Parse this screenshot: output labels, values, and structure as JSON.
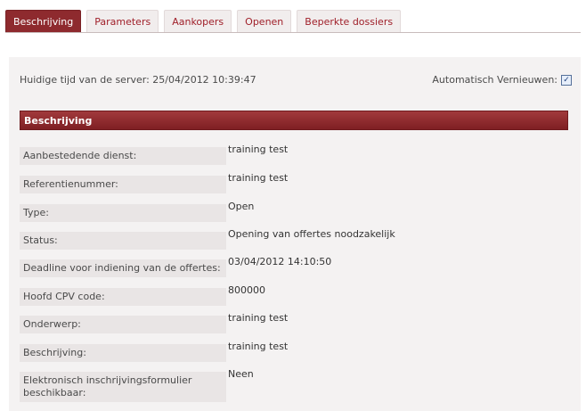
{
  "tabs": [
    {
      "label": "Beschrijving",
      "active": true
    },
    {
      "label": "Parameters",
      "active": false
    },
    {
      "label": "Aankopers",
      "active": false
    },
    {
      "label": "Openen",
      "active": false
    },
    {
      "label": "Beperkte dossiers",
      "active": false
    }
  ],
  "server": {
    "time_text": "Huidige tijd van de server: 25/04/2012 10:39:47",
    "auto_refresh_label": "Automatisch Vernieuwen:",
    "auto_refresh_checked": true
  },
  "section": {
    "title": "Beschrijving"
  },
  "fields": [
    {
      "label": "Aanbestedende dienst:",
      "value": "training test"
    },
    {
      "label": "Referentienummer:",
      "value": "training test"
    },
    {
      "label": "Type:",
      "value": "Open"
    },
    {
      "label": "Status:",
      "value": "Opening van offertes noodzakelijk"
    },
    {
      "label": "Deadline voor indiening van de offertes:",
      "value": "03/04/2012 14:10:50"
    },
    {
      "label": "Hoofd CPV code:",
      "value": "800000"
    },
    {
      "label": "Onderwerp:",
      "value": "training test"
    },
    {
      "label": "Beschrijving:",
      "value": "training test"
    },
    {
      "label": "Elektronisch inschrijvingsformulier beschikbaar:",
      "value": "Neen"
    }
  ],
  "colors": {
    "accent": "#8e2a2e",
    "tab_text": "#a0202a",
    "panel_bg": "#f4f2f2"
  }
}
